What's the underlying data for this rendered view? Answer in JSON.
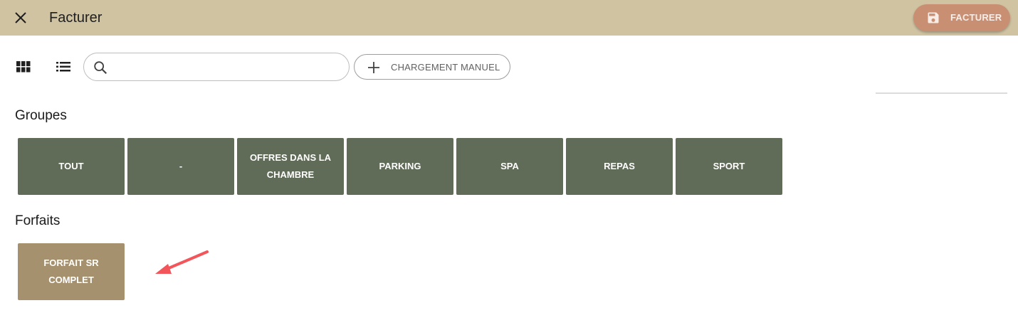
{
  "header": {
    "title": "Facturer",
    "close_icon": "close-icon",
    "invoice_button": {
      "label": "FACTURER",
      "icon": "save-icon"
    },
    "background_color": "#d0c3a2",
    "button_color": "#c98f73"
  },
  "toolbar": {
    "grid_view_icon": "grid-view-icon",
    "list_view_icon": "list-view-icon",
    "search": {
      "value": "",
      "placeholder": "",
      "icon": "search-icon"
    },
    "manual_button": {
      "label": "CHARGEMENT MANUEL",
      "icon": "plus-icon"
    }
  },
  "groups": {
    "title": "Groupes",
    "tile_color": "#606b58",
    "items": [
      {
        "label": "TOUT"
      },
      {
        "label": "-"
      },
      {
        "label": "OFFRES DANS LA CHAMBRE"
      },
      {
        "label": "PARKING"
      },
      {
        "label": "SPA"
      },
      {
        "label": "REPAS"
      },
      {
        "label": "SPORT"
      }
    ]
  },
  "packages": {
    "title": "Forfaits",
    "tile_color": "#a6916f",
    "items": [
      {
        "label": "FORFAIT SR COMPLET"
      }
    ]
  },
  "annotation": {
    "icon": "arrow-icon",
    "color": "#f2555a"
  }
}
